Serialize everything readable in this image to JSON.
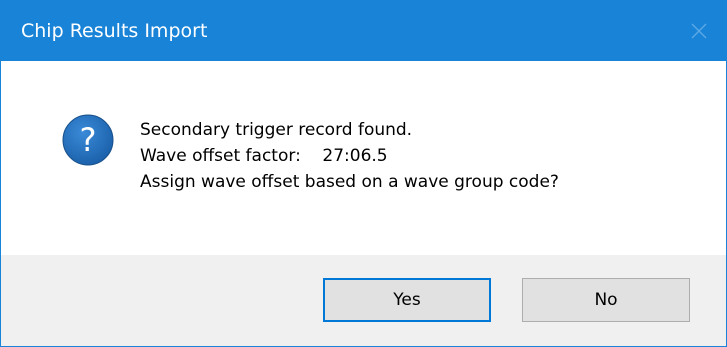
{
  "window": {
    "title": "Chip Results Import",
    "close_icon": "close-icon",
    "accent": "#1883d7"
  },
  "message": {
    "icon": "question-icon",
    "lines": [
      "Secondary trigger record found.",
      "Wave offset factor:    27:06.5",
      "Assign wave offset based on a wave group code?"
    ]
  },
  "buttons": {
    "yes_label": "Yes",
    "no_label": "No"
  }
}
